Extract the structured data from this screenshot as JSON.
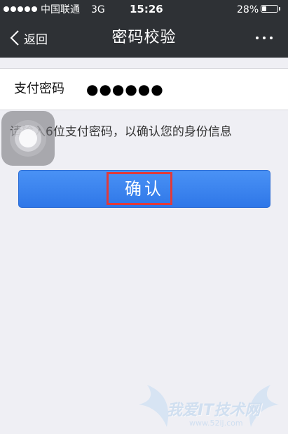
{
  "status_bar": {
    "carrier": "中国联通",
    "network": "3G",
    "time": "15:26",
    "battery_text": "28%",
    "battery_level": 0.28,
    "signal_bars": 5
  },
  "nav": {
    "back_label": "返回",
    "title": "密码校验",
    "back_icon": "chevron-left-icon",
    "more_icon": "more-dots-icon"
  },
  "password": {
    "label": "支付密码",
    "masked_value": "●●●●●●"
  },
  "hint": "请输入6位支付密码，以确认您的身份信息",
  "confirm_button": {
    "label": "确认",
    "color": "#3a84f0",
    "highlight_color": "#e03a3a"
  },
  "watermark": {
    "text": "我爱IT技术网",
    "url": "www.52ij.com"
  },
  "colors": {
    "header_bg": "#2e3135",
    "page_bg": "#efeff4"
  }
}
